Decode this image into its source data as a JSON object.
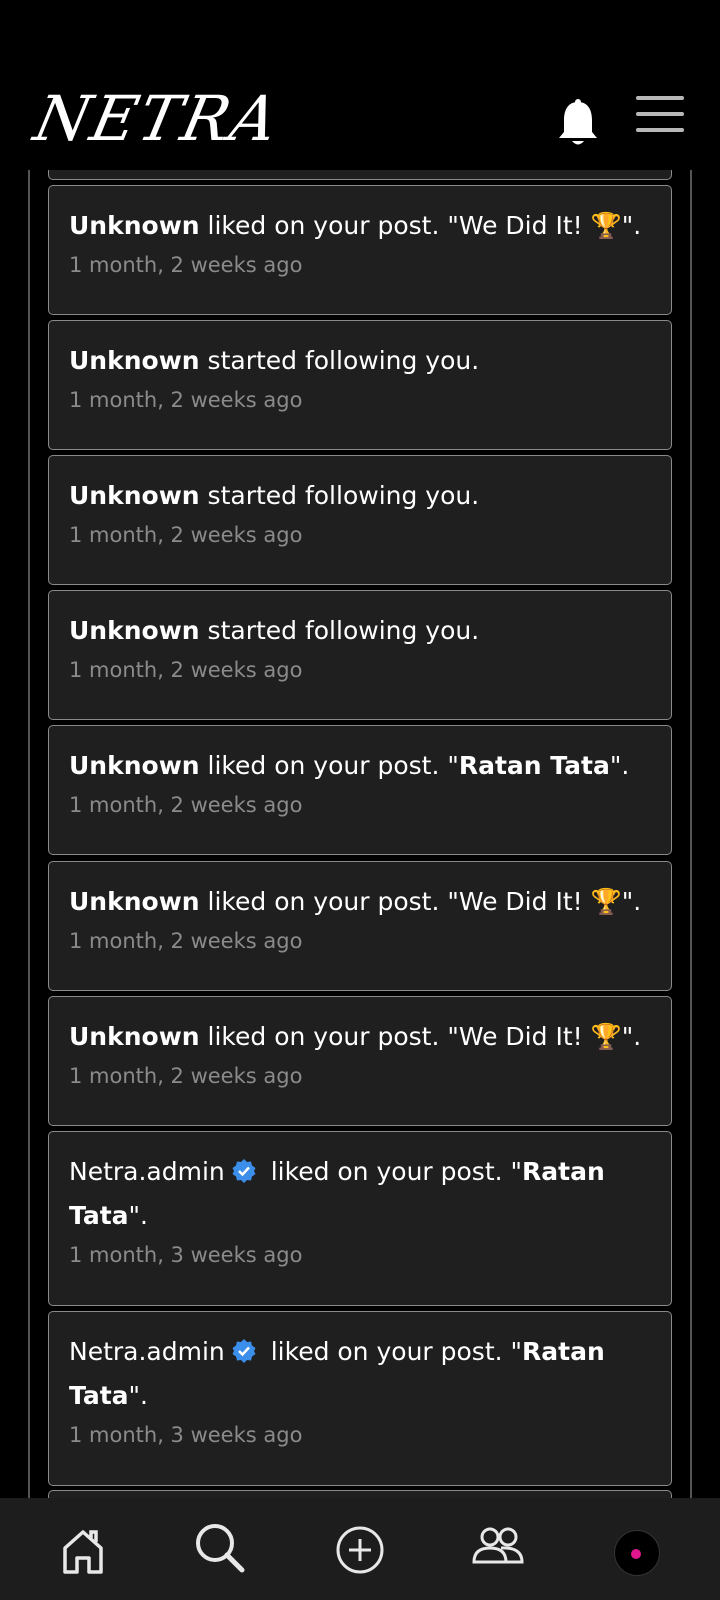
{
  "app": {
    "logo_text": "NETRA"
  },
  "header": {
    "bell_icon": "bell-icon",
    "menu_icon": "hamburger-menu-icon"
  },
  "notifications": [
    {
      "user": "Unknown",
      "action": " liked on your post. \"We Did It! 🏆\".",
      "post": "",
      "time": "1 month, 2 weeks ago"
    },
    {
      "user": "Unknown",
      "action": " started following you.",
      "post": "",
      "time": "1 month, 2 weeks ago"
    },
    {
      "user": "Unknown",
      "action": " started following you.",
      "post": "",
      "time": "1 month, 2 weeks ago"
    },
    {
      "user": "Unknown",
      "action": " started following you.",
      "post": "",
      "time": "1 month, 2 weeks ago"
    },
    {
      "user": "Unknown",
      "action": " liked on your post. \"",
      "post": "Ratan Tata",
      "after": "\".",
      "time": "1 month, 2 weeks ago"
    },
    {
      "user": "Unknown",
      "action": " liked on your post. \"We Did It! 🏆\".",
      "post": "",
      "time": "1 month, 2 weeks ago"
    },
    {
      "user": "Unknown",
      "action": " liked on your post. \"We Did It! 🏆\".",
      "post": "",
      "time": "1 month, 2 weeks ago"
    },
    {
      "user": "Netra.admin",
      "action": " liked on your post. \"",
      "post": "Ratan",
      "post2": "Tata",
      "after": "\".",
      "time": "1 month, 3 weeks ago"
    },
    {
      "user": "Netra.admin",
      "action": " liked on your post. \"",
      "post": "Ratan",
      "post2": "Tata",
      "after": "\".",
      "time": "1 month, 3 weeks ago"
    }
  ],
  "bottom_nav": {
    "items": [
      "home-icon",
      "search-icon",
      "add-post-icon",
      "people-icon",
      "profile-avatar"
    ]
  },
  "colors": {
    "card_bg": "#1f1f20",
    "border": "#8a8a8a",
    "verified": "#3b8eea",
    "avatar_dot": "#e0168c"
  }
}
